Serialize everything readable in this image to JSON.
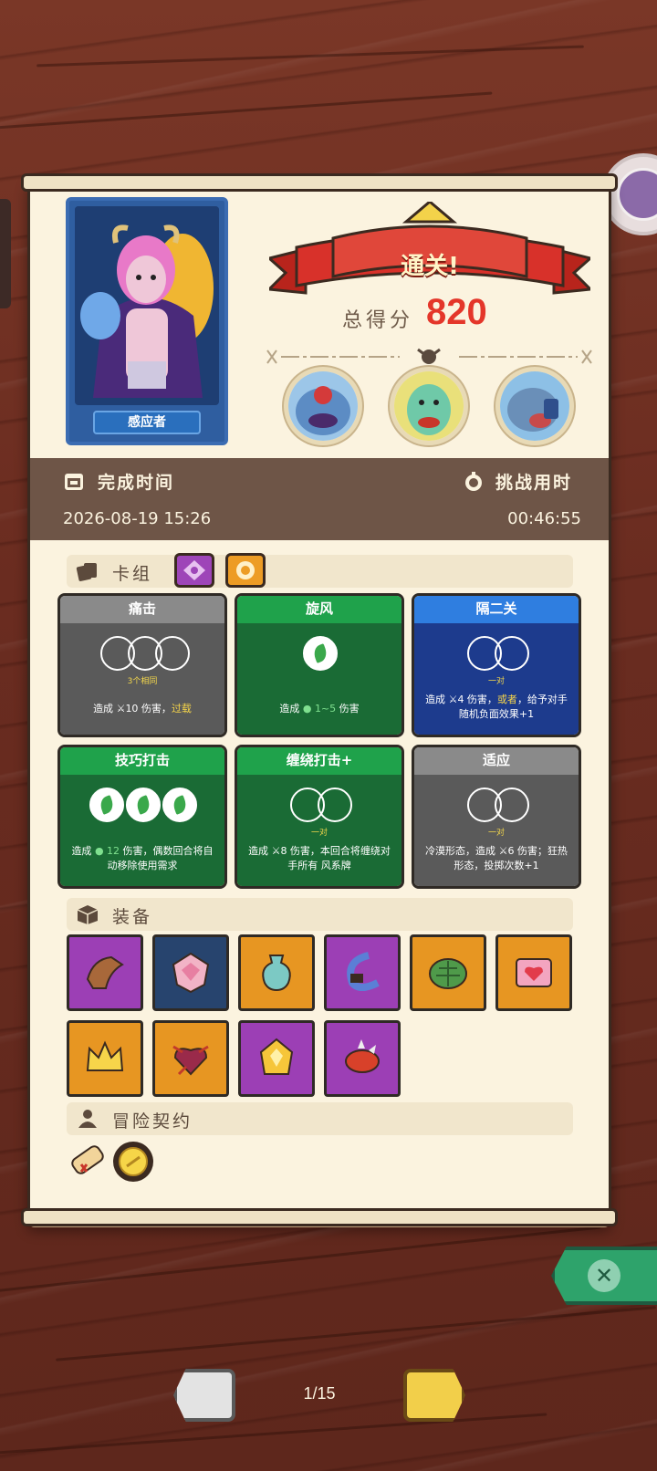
{
  "result": {
    "banner_text": "通关!",
    "score_label": "总得分",
    "score_value": "820"
  },
  "hero": {
    "name": "感应者"
  },
  "time": {
    "completion_label": "完成时间",
    "completion_value": "2026-08-19  15:26",
    "challenge_label": "挑战用时",
    "challenge_value": "00:46:55"
  },
  "sections": {
    "deck": "卡组",
    "equipment": "装备",
    "contract": "冒险契约"
  },
  "cards": [
    {
      "name": "痛击",
      "sub": "3个相同",
      "desc_pre": "造成 ",
      "desc_num": "10",
      "desc_mid": " 伤害，",
      "desc_hl": "过载",
      "desc_post": ""
    },
    {
      "name": "旋风",
      "sub": "",
      "desc_pre": "造成 ",
      "desc_num": "1~5",
      "desc_mid": " 伤害",
      "desc_hl": "",
      "desc_post": ""
    },
    {
      "name": "隔二关",
      "sub": "一对",
      "desc_pre": "造成 ",
      "desc_num": "4",
      "desc_mid": " 伤害，",
      "desc_hl": "或者",
      "desc_post": "，给予对手随机负面效果+1"
    },
    {
      "name": "技巧打击",
      "sub": "",
      "desc_pre": "造成 ",
      "desc_num": "12",
      "desc_mid": " 伤害，偶数回合将自动移除使用需求",
      "desc_hl": "",
      "desc_post": ""
    },
    {
      "name": "缠绕打击+",
      "sub": "一对",
      "desc_pre": "造成 ",
      "desc_num": "8",
      "desc_mid": " 伤害，本回合将",
      "desc_hl": "",
      "desc_post": "缠绕对手所有 风系牌"
    },
    {
      "name": "适应",
      "sub": "一对",
      "desc_pre": "冷漠形态，造成 ",
      "desc_num": "6",
      "desc_mid": " 伤害；狂热形态，投掷次数+1",
      "desc_hl": "",
      "desc_post": ""
    }
  ],
  "equipment": [
    {
      "icon": "leather-armor-icon",
      "color": "purple"
    },
    {
      "icon": "crystal-dice-icon",
      "color": "navy"
    },
    {
      "icon": "vase-icon",
      "color": "orange"
    },
    {
      "icon": "hook-icon",
      "color": "purple"
    },
    {
      "icon": "turtle-shell-icon",
      "color": "orange"
    },
    {
      "icon": "heart-box-icon",
      "color": "orange"
    },
    {
      "icon": "crown-icon",
      "color": "orange"
    },
    {
      "icon": "thorn-heart-icon",
      "color": "orange"
    },
    {
      "icon": "gem-icon",
      "color": "purple"
    },
    {
      "icon": "spiked-bracelet-icon",
      "color": "purple"
    }
  ],
  "contracts": [
    {
      "icon": "scroll-icon"
    },
    {
      "icon": "coin-icon"
    }
  ],
  "pagination": {
    "current": "1/15"
  },
  "colors": {
    "score": "#e4362a",
    "banner": "#d8312a",
    "time_bar": "#6e5547",
    "close": "#2ea36b"
  }
}
